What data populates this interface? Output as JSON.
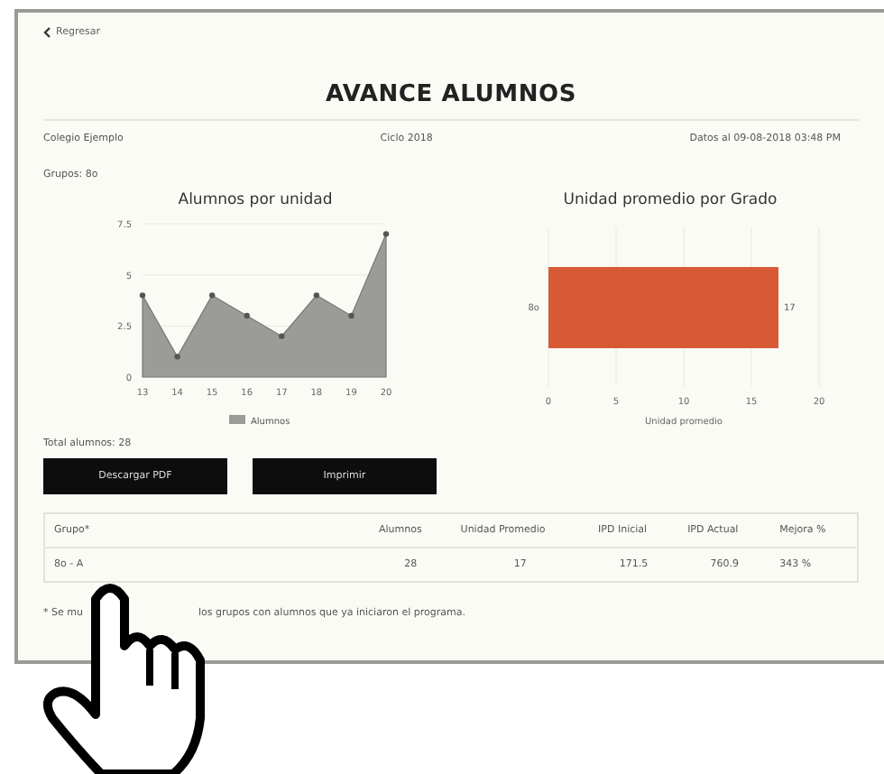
{
  "back_link": {
    "label": "Regresar"
  },
  "title": "AVANCE ALUMNOS",
  "info": {
    "school": "Colegio Ejemplo",
    "cycle": "Ciclo 2018",
    "date": "Datos al 09-08-2018 03:48 PM"
  },
  "groups": "Grupos: 8o",
  "charts": [
    {
      "chart_data": {
        "type": "area",
        "title": "Alumnos por unidad",
        "categories": [
          "13",
          "14",
          "15",
          "16",
          "17",
          "18",
          "19",
          "20"
        ],
        "series": [
          {
            "name": "Alumnos",
            "color": "#9b9b97",
            "values": [
              4,
              1,
              4,
              3,
              2,
              4,
              3,
              7
            ]
          }
        ],
        "ylim": [
          0,
          7.5
        ],
        "yticks": [
          0,
          {
            "value": 2.5,
            "label": "2.5"
          },
          5,
          {
            "value": 7.5,
            "label": "7.5"
          }
        ]
      }
    },
    {
      "chart_data": {
        "type": "bar",
        "orientation": "horizontal",
        "title": "Unidad promedio por Grado",
        "categories": [
          "8o"
        ],
        "values": [
          17
        ],
        "xlabel": "Unidad promedio",
        "xlim": [
          0,
          20
        ],
        "xticks": [
          0,
          5,
          10,
          15,
          20
        ],
        "data_labels": true,
        "grid": true
      }
    }
  ],
  "total": "Total alumnos: 28",
  "buttons": [
    "Descargar PDF",
    "Imprimir"
  ],
  "table": {
    "columns": [
      "Grupo*",
      "Alumnos",
      "Unidad Promedio",
      "IPD Inicial",
      "IPD Actual",
      "Mejora %"
    ],
    "rows": [
      [
        "8o - A",
        "28",
        "17",
        "171.5",
        "760.9",
        "343 %"
      ]
    ]
  },
  "footnote": [
    "* Se mu",
    "los grupos con alumnos que ya iniciaron el programa."
  ]
}
